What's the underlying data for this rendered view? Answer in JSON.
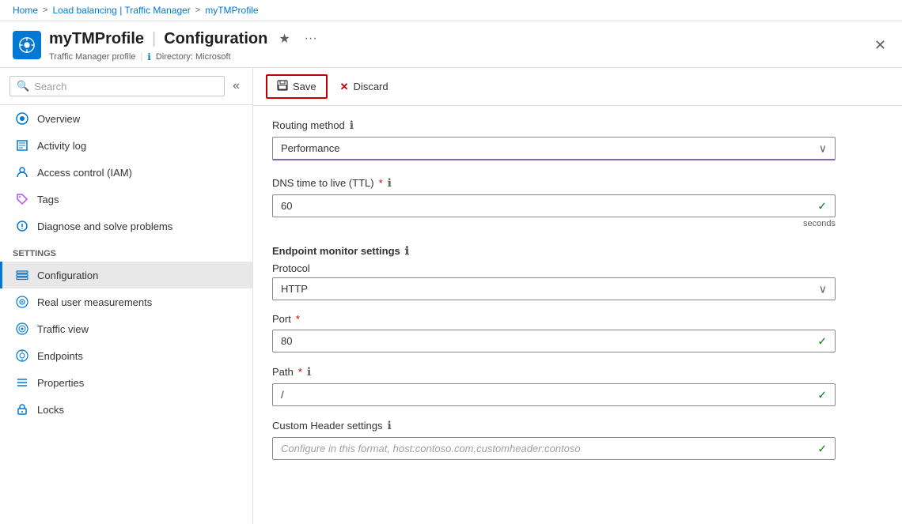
{
  "breadcrumb": {
    "home": "Home",
    "sep1": ">",
    "loadbalancing": "Load balancing | Traffic Manager",
    "sep2": ">",
    "profile": "myTMProfile"
  },
  "header": {
    "resource_name": "myTMProfile",
    "pipe": "|",
    "page_title": "Configuration",
    "resource_type": "Traffic Manager profile",
    "directory_label": "Directory: Microsoft",
    "favorite_icon": "★",
    "more_icon": "···",
    "close_icon": "✕"
  },
  "sidebar": {
    "search_placeholder": "Search",
    "collapse_icon": "«",
    "nav_items": [
      {
        "id": "overview",
        "label": "Overview",
        "icon": "🌐"
      },
      {
        "id": "activity-log",
        "label": "Activity log",
        "icon": "📋"
      },
      {
        "id": "iam",
        "label": "Access control (IAM)",
        "icon": "👤"
      },
      {
        "id": "tags",
        "label": "Tags",
        "icon": "🏷"
      },
      {
        "id": "diagnose",
        "label": "Diagnose and solve problems",
        "icon": "🔧"
      }
    ],
    "settings_label": "Settings",
    "settings_items": [
      {
        "id": "configuration",
        "label": "Configuration",
        "icon": "⚙",
        "active": true
      },
      {
        "id": "real-user",
        "label": "Real user measurements",
        "icon": "🌐"
      },
      {
        "id": "traffic-view",
        "label": "Traffic view",
        "icon": "🌐"
      },
      {
        "id": "endpoints",
        "label": "Endpoints",
        "icon": "🌐"
      },
      {
        "id": "properties",
        "label": "Properties",
        "icon": "📊"
      },
      {
        "id": "locks",
        "label": "Locks",
        "icon": "🔒"
      }
    ]
  },
  "toolbar": {
    "save_label": "Save",
    "save_icon": "💾",
    "discard_label": "Discard",
    "discard_icon": "✕"
  },
  "form": {
    "routing_method_label": "Routing method",
    "routing_method_info": "ℹ",
    "routing_method_value": "Performance",
    "dns_ttl_label": "DNS time to live (TTL)",
    "dns_ttl_required": "*",
    "dns_ttl_info": "ℹ",
    "dns_ttl_value": "60",
    "dns_ttl_hint": "seconds",
    "endpoint_monitor_label": "Endpoint monitor settings",
    "endpoint_monitor_info": "ℹ",
    "protocol_label": "Protocol",
    "protocol_value": "HTTP",
    "port_label": "Port",
    "port_required": "*",
    "port_value": "80",
    "path_label": "Path",
    "path_required": "*",
    "path_info": "ℹ",
    "path_value": "/",
    "custom_header_label": "Custom Header settings",
    "custom_header_info": "ℹ",
    "custom_header_placeholder": "Configure in this format, host:contoso.com,customheader:contoso"
  }
}
